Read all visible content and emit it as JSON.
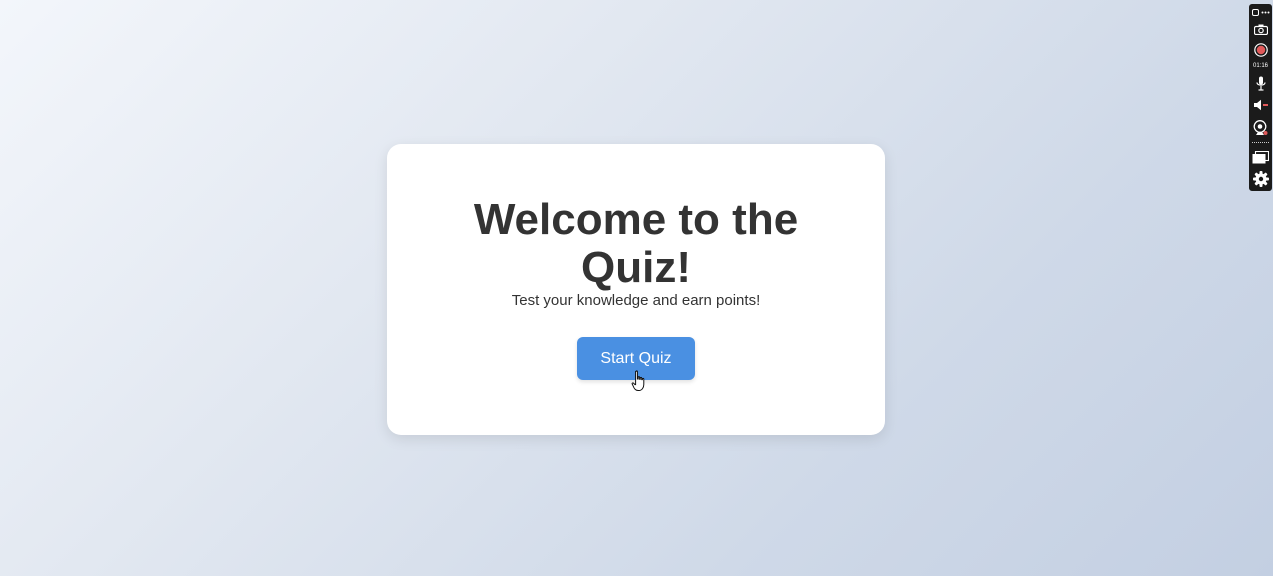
{
  "card": {
    "title": "Welcome to the Quiz!",
    "subtitle": "Test your knowledge and earn points!",
    "start_label": "Start Quiz"
  },
  "recorder_toolbar": {
    "timer": "01:16",
    "icons": [
      "expand-icon",
      "more-icon",
      "camera-icon",
      "record-icon",
      "microphone-icon",
      "speaker-icon",
      "webcam-icon",
      "screen-icon",
      "gear-icon"
    ]
  },
  "colors": {
    "accent": "#4a90e2",
    "title_text": "#333333",
    "card_bg": "#ffffff",
    "record_red": "#e05a5a"
  }
}
